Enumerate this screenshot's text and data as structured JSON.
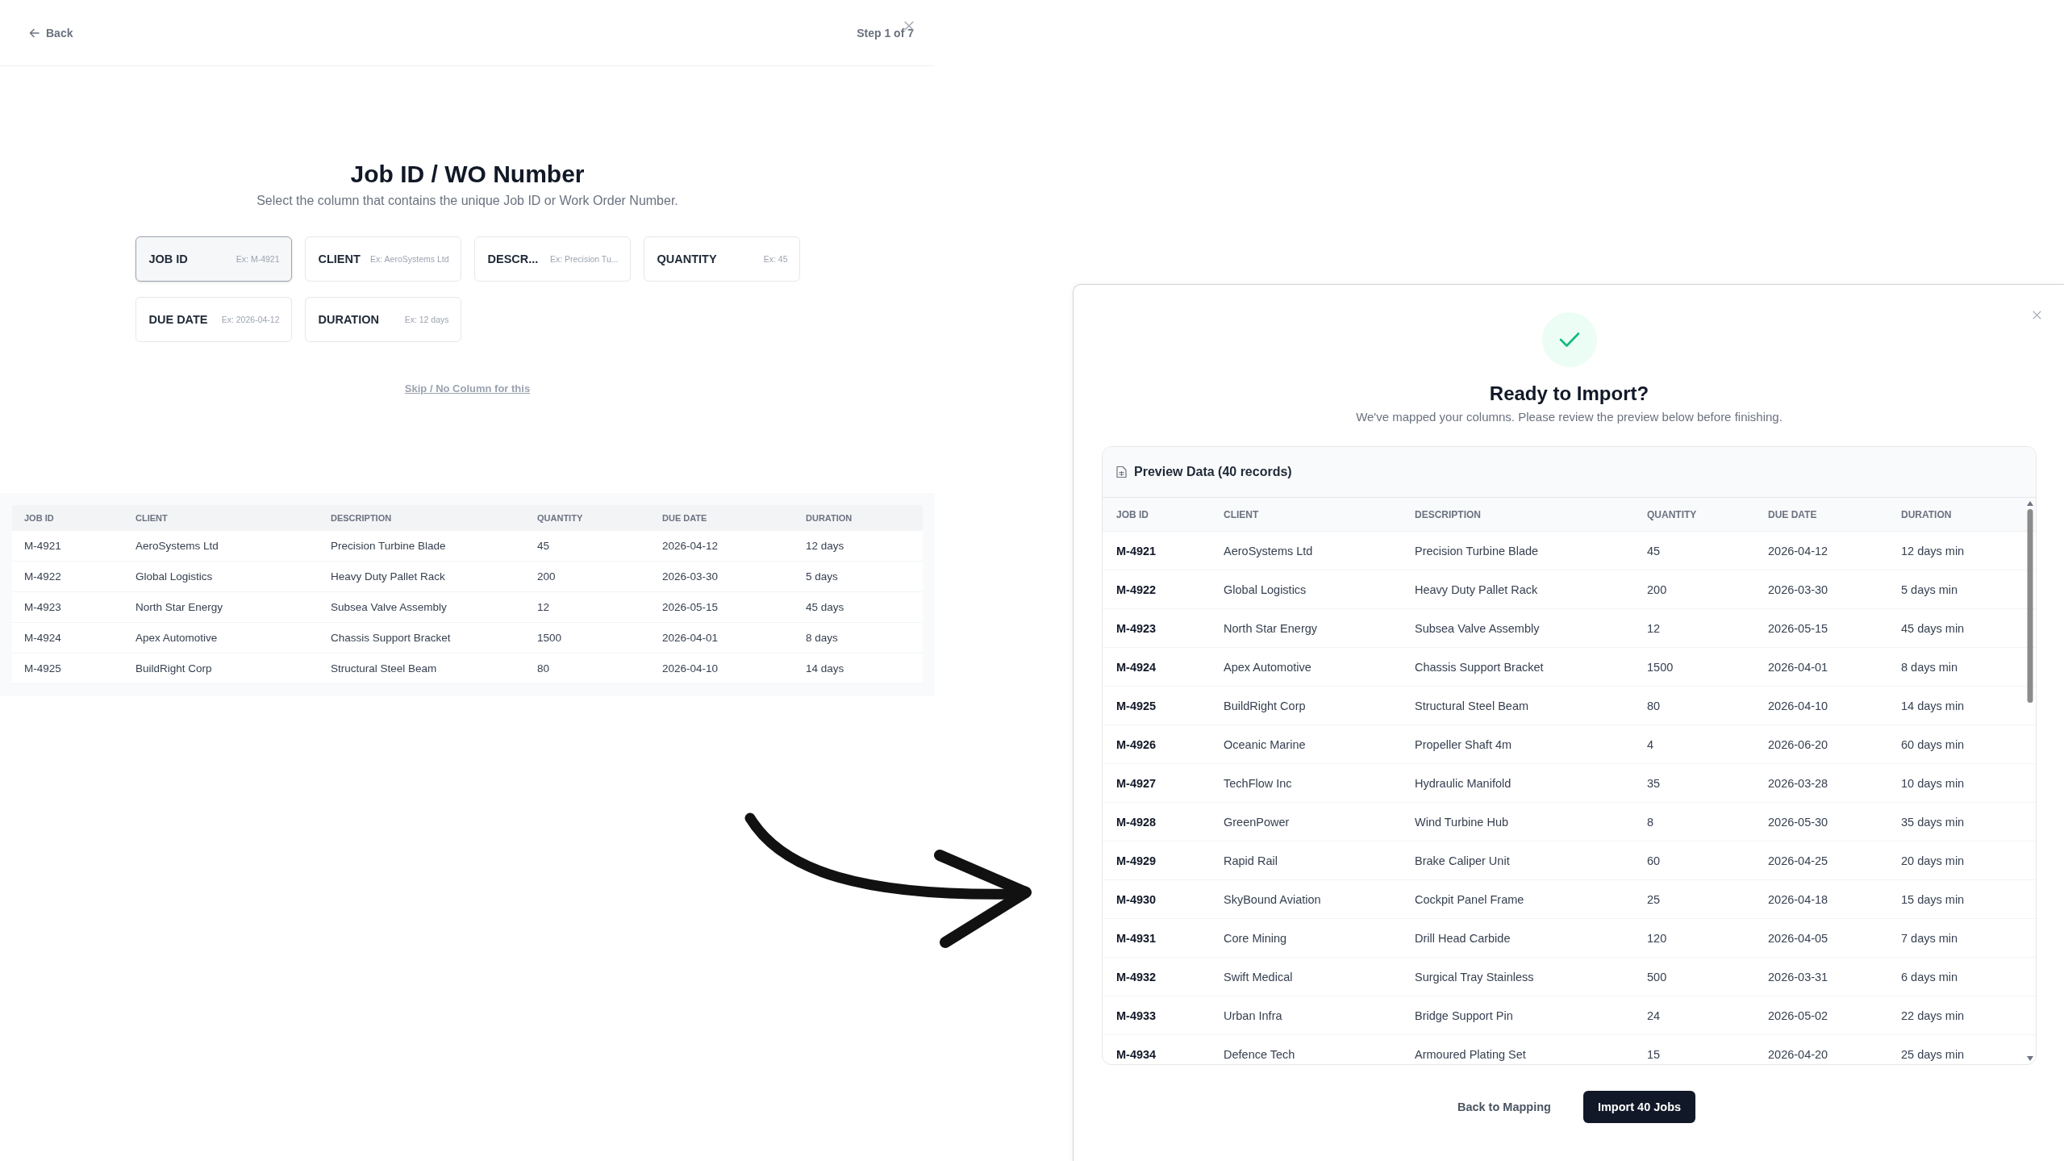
{
  "mapping_screen": {
    "back": "Back",
    "step": "Step 1 of 7",
    "title": "Job ID / WO Number",
    "subtitle": "Select the column that contains the unique Job ID or Work Order Number.",
    "options": [
      {
        "label": "JOB ID",
        "example": "Ex: M-4921",
        "selected": true
      },
      {
        "label": "CLIENT",
        "example": "Ex: AeroSystems Ltd",
        "selected": false
      },
      {
        "label": "DESCR...",
        "example": "Ex: Precision Tu...",
        "selected": false
      },
      {
        "label": "QUANTITY",
        "example": "Ex: 45",
        "selected": false
      },
      {
        "label": "DUE DATE",
        "example": "Ex: 2026-04-12",
        "selected": false
      },
      {
        "label": "DURATION",
        "example": "Ex: 12 days",
        "selected": false
      }
    ],
    "skip_link": "Skip / No Column for this",
    "sample_table": {
      "columns": [
        "JOB ID",
        "CLIENT",
        "DESCRIPTION",
        "QUANTITY",
        "DUE DATE",
        "DURATION"
      ],
      "rows": [
        [
          "M-4921",
          "AeroSystems Ltd",
          "Precision Turbine Blade",
          "45",
          "2026-04-12",
          "12 days"
        ],
        [
          "M-4922",
          "Global Logistics",
          "Heavy Duty Pallet Rack",
          "200",
          "2026-03-30",
          "5 days"
        ],
        [
          "M-4923",
          "North Star Energy",
          "Subsea Valve Assembly",
          "12",
          "2026-05-15",
          "45 days"
        ],
        [
          "M-4924",
          "Apex Automotive",
          "Chassis Support Bracket",
          "1500",
          "2026-04-01",
          "8 days"
        ],
        [
          "M-4925",
          "BuildRight Corp",
          "Structural Steel Beam",
          "80",
          "2026-04-10",
          "14 days"
        ]
      ]
    }
  },
  "import_dialog": {
    "title": "Ready to Import?",
    "subtitle": "We've mapped your columns. Please review the preview below before finishing.",
    "preview": {
      "title": "Preview Data (40 records)",
      "columns": [
        "JOB ID",
        "CLIENT",
        "DESCRIPTION",
        "QUANTITY",
        "DUE DATE",
        "DURATION"
      ],
      "rows": [
        [
          "M-4921",
          "AeroSystems Ltd",
          "Precision Turbine Blade",
          "45",
          "2026-04-12",
          "12 days min"
        ],
        [
          "M-4922",
          "Global Logistics",
          "Heavy Duty Pallet Rack",
          "200",
          "2026-03-30",
          "5 days min"
        ],
        [
          "M-4923",
          "North Star Energy",
          "Subsea Valve Assembly",
          "12",
          "2026-05-15",
          "45 days min"
        ],
        [
          "M-4924",
          "Apex Automotive",
          "Chassis Support Bracket",
          "1500",
          "2026-04-01",
          "8 days min"
        ],
        [
          "M-4925",
          "BuildRight Corp",
          "Structural Steel Beam",
          "80",
          "2026-04-10",
          "14 days min"
        ],
        [
          "M-4926",
          "Oceanic Marine",
          "Propeller Shaft 4m",
          "4",
          "2026-06-20",
          "60 days min"
        ],
        [
          "M-4927",
          "TechFlow Inc",
          "Hydraulic Manifold",
          "35",
          "2026-03-28",
          "10 days min"
        ],
        [
          "M-4928",
          "GreenPower",
          "Wind Turbine Hub",
          "8",
          "2026-05-30",
          "35 days min"
        ],
        [
          "M-4929",
          "Rapid Rail",
          "Brake Caliper Unit",
          "60",
          "2026-04-25",
          "20 days min"
        ],
        [
          "M-4930",
          "SkyBound Aviation",
          "Cockpit Panel Frame",
          "25",
          "2026-04-18",
          "15 days min"
        ],
        [
          "M-4931",
          "Core Mining",
          "Drill Head Carbide",
          "120",
          "2026-04-05",
          "7 days min"
        ],
        [
          "M-4932",
          "Swift Medical",
          "Surgical Tray Stainless",
          "500",
          "2026-03-31",
          "6 days min"
        ],
        [
          "M-4933",
          "Urban Infra",
          "Bridge Support Pin",
          "24",
          "2026-05-02",
          "22 days min"
        ],
        [
          "M-4934",
          "Defence Tech",
          "Armoured Plating Set",
          "15",
          "2026-04-20",
          "25 days min"
        ]
      ]
    },
    "buttons": [
      {
        "label": "Back to Mapping",
        "kind": "secondary"
      },
      {
        "label": "Import 40 Jobs",
        "kind": "primary"
      }
    ]
  }
}
